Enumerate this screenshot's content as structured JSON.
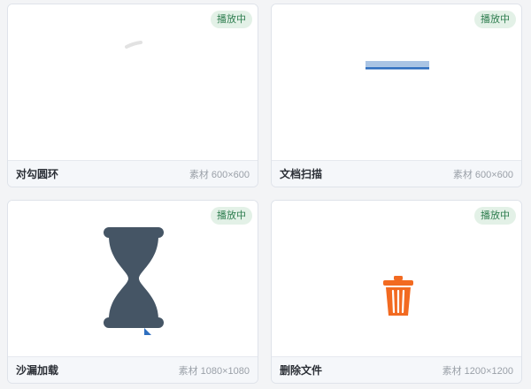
{
  "cards": [
    {
      "title": "对勾圆环",
      "badge": "播放中",
      "asset_label": "素材",
      "dims": "600×600",
      "icon": "checkmark-ring-icon"
    },
    {
      "title": "文档扫描",
      "badge": "播放中",
      "asset_label": "素材",
      "dims": "600×600",
      "icon": "document-scan-icon"
    },
    {
      "title": "沙漏加载",
      "badge": "播放中",
      "asset_label": "素材",
      "dims": "1080×1080",
      "icon": "hourglass-icon"
    },
    {
      "title": "删除文件",
      "badge": "播放中",
      "asset_label": "素材",
      "dims": "1200×1200",
      "icon": "trash-icon"
    }
  ],
  "colors": {
    "badge_bg": "#e3f1e7",
    "badge_text": "#2e7d4f",
    "hourglass": "#455565",
    "scan_line": "#a9c4e4",
    "scan_line_edge": "#2f6fbf",
    "trash": "#f26a21"
  }
}
